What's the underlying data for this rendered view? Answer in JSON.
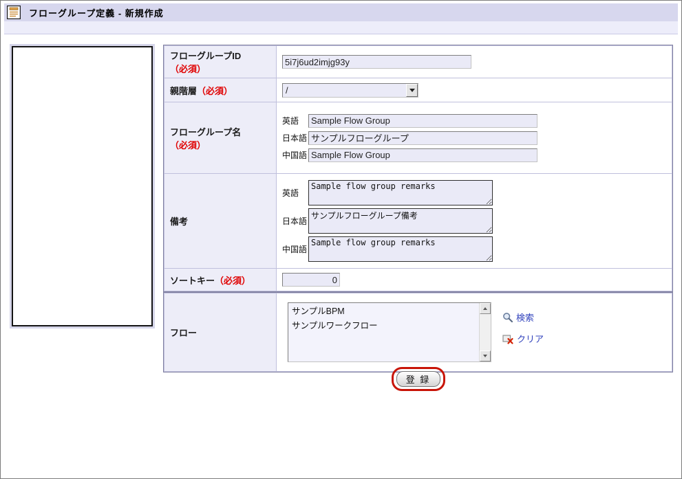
{
  "header": {
    "title": "フローグループ定義 - 新規作成",
    "icon": "form-document-icon"
  },
  "required_mark": "（必須）",
  "table1": {
    "rows": {
      "id": {
        "label": "フローグループID",
        "value": "5i7j6ud2imjg93y"
      },
      "parent": {
        "label": "親階層",
        "selected_option": "/"
      },
      "name": {
        "label": "フローグループ名",
        "fields": [
          {
            "lang": "英語",
            "value": "Sample Flow Group"
          },
          {
            "lang": "日本語",
            "value": "サンプルフローグループ"
          },
          {
            "lang": "中国語",
            "value": "Sample Flow Group"
          }
        ]
      },
      "remarks": {
        "label": "備考",
        "fields": [
          {
            "lang": "英語",
            "value": "Sample flow group remarks"
          },
          {
            "lang": "日本語",
            "value": "サンプルフローグループ備考"
          },
          {
            "lang": "中国語",
            "value": "Sample flow group remarks"
          }
        ]
      },
      "sortkey": {
        "label": "ソートキー",
        "value": "0"
      }
    }
  },
  "table2": {
    "flow": {
      "label": "フロー",
      "items": [
        "サンプルBPM",
        "サンプルワークフロー"
      ],
      "actions": {
        "search": "検索",
        "clear": "クリア"
      }
    }
  },
  "submit": {
    "label": "登 録"
  },
  "colors": {
    "header_bg": "#d7d7ee",
    "label_cell_bg": "#ededf8",
    "required_red": "#e00000",
    "link_blue": "#3243bd",
    "highlight_red": "#c81407"
  }
}
